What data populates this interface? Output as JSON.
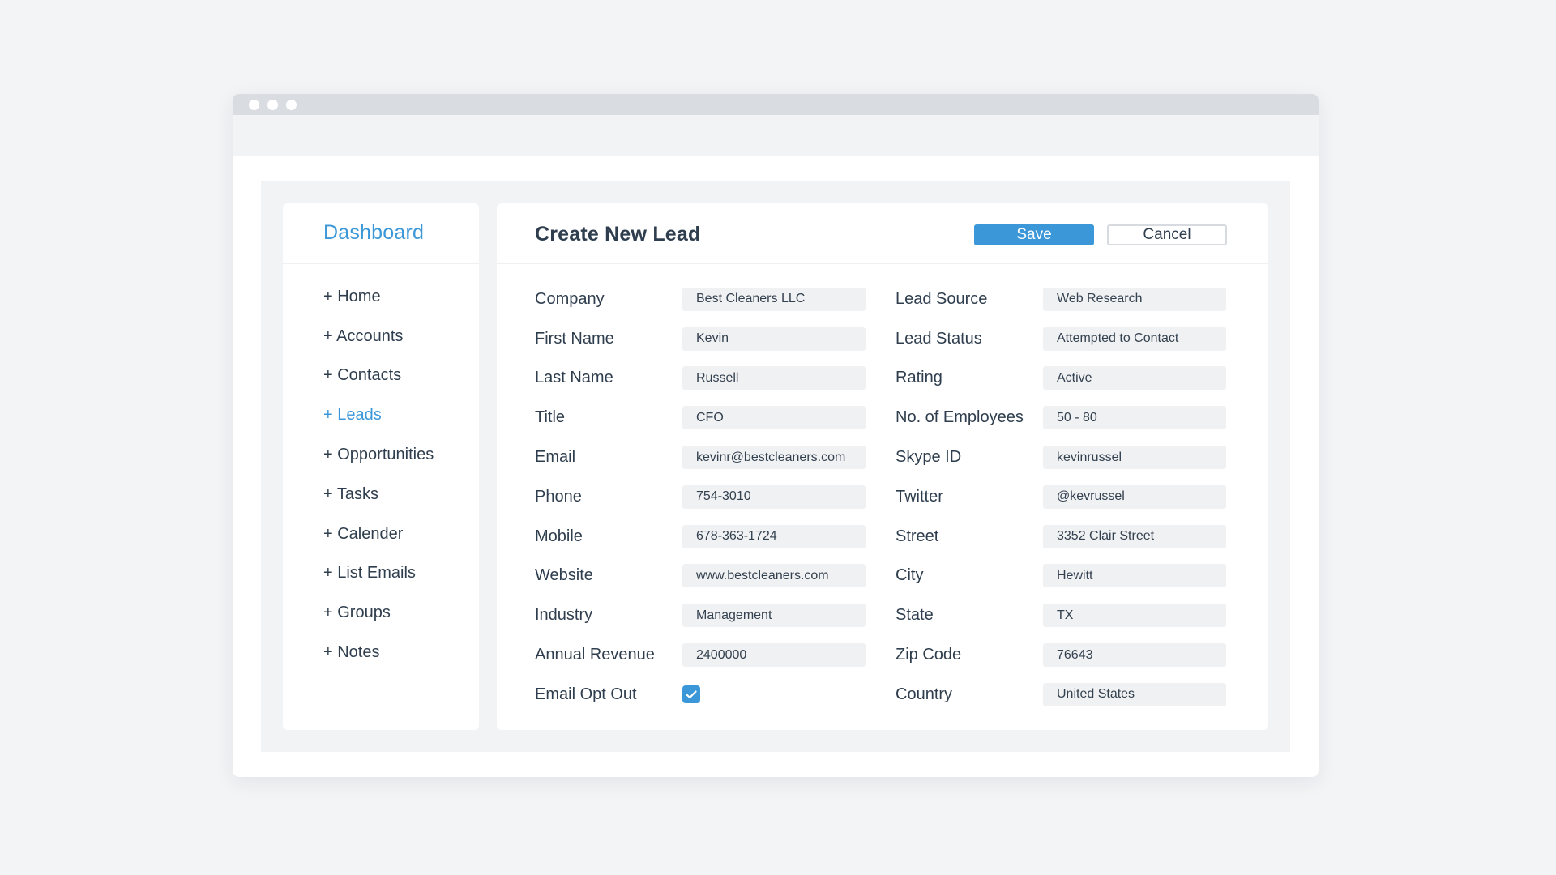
{
  "colors": {
    "accent": "#3b97d8",
    "text": "#2f3e4e",
    "field_bg": "#f0f1f3",
    "page_bg": "#f3f4f6"
  },
  "sidebar": {
    "title": "Dashboard",
    "items": [
      {
        "label": "+ Home",
        "active": false
      },
      {
        "label": "+ Accounts",
        "active": false
      },
      {
        "label": "+ Contacts",
        "active": false
      },
      {
        "label": "+ Leads",
        "active": true
      },
      {
        "label": "+ Opportunities",
        "active": false
      },
      {
        "label": "+ Tasks",
        "active": false
      },
      {
        "label": "+ Calender",
        "active": false
      },
      {
        "label": "+ List Emails",
        "active": false
      },
      {
        "label": "+ Groups",
        "active": false
      },
      {
        "label": "+ Notes",
        "active": false
      }
    ]
  },
  "header": {
    "title": "Create New Lead",
    "save_label": "Save",
    "cancel_label": "Cancel"
  },
  "form": {
    "left": [
      {
        "label": "Company",
        "value": "Best Cleaners LLC"
      },
      {
        "label": "First Name",
        "value": "Kevin"
      },
      {
        "label": "Last Name",
        "value": "Russell"
      },
      {
        "label": "Title",
        "value": "CFO"
      },
      {
        "label": "Email",
        "value": "kevinr@bestcleaners.com"
      },
      {
        "label": "Phone",
        "value": "754-3010"
      },
      {
        "label": "Mobile",
        "value": "678-363-1724"
      },
      {
        "label": "Website",
        "value": "www.bestcleaners.com"
      },
      {
        "label": "Industry",
        "value": "Management"
      },
      {
        "label": "Annual Revenue",
        "value": "2400000"
      },
      {
        "label": "Email Opt Out",
        "checked": true
      }
    ],
    "right": [
      {
        "label": "Lead Source",
        "value": "Web Research"
      },
      {
        "label": "Lead Status",
        "value": "Attempted to Contact"
      },
      {
        "label": "Rating",
        "value": "Active"
      },
      {
        "label": "No. of Employees",
        "value": "50 - 80"
      },
      {
        "label": "Skype ID",
        "value": "kevinrussel"
      },
      {
        "label": "Twitter",
        "value": "@kevrussel"
      },
      {
        "label": "Street",
        "value": "3352 Clair Street"
      },
      {
        "label": "City",
        "value": "Hewitt"
      },
      {
        "label": "State",
        "value": "TX"
      },
      {
        "label": "Zip Code",
        "value": "76643"
      },
      {
        "label": "Country",
        "value": "United States"
      }
    ]
  }
}
